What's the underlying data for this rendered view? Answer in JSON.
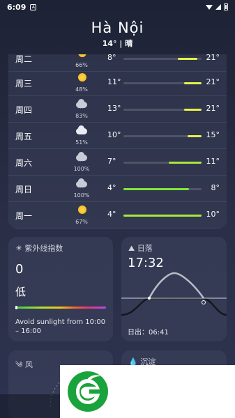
{
  "status": {
    "time": "6:09"
  },
  "header": {
    "city": "Hà Nội",
    "current": "14° | 晴"
  },
  "forecast": [
    {
      "day": "周二",
      "icon": "sun-icon",
      "precip": "66%",
      "low": "8°",
      "high": "21°",
      "bar_from": 0.7,
      "bar_to": 0.95,
      "color": "#e8f04a"
    },
    {
      "day": "周三",
      "icon": "sun-icon",
      "precip": "48%",
      "low": "11°",
      "high": "21°",
      "bar_from": 0.78,
      "bar_to": 1.0,
      "color": "#e8f04a"
    },
    {
      "day": "周四",
      "icon": "rain-icon",
      "precip": "83%",
      "low": "13°",
      "high": "21°",
      "bar_from": 0.78,
      "bar_to": 1.0,
      "color": "#e8f04a"
    },
    {
      "day": "周五",
      "icon": "cloud-icon",
      "precip": "51%",
      "low": "10°",
      "high": "15°",
      "bar_from": 0.82,
      "bar_to": 1.0,
      "color": "#e8f04a"
    },
    {
      "day": "周六",
      "icon": "rain-icon",
      "precip": "100%",
      "low": "7°",
      "high": "11°",
      "bar_from": 0.58,
      "bar_to": 1.0,
      "color": "#a8e83a"
    },
    {
      "day": "周日",
      "icon": "rain-icon",
      "precip": "100%",
      "low": "4°",
      "high": "8°",
      "bar_from": 0.0,
      "bar_to": 0.84,
      "color": "#7ee83a"
    },
    {
      "day": "周一",
      "icon": "sun-icon",
      "precip": "67%",
      "low": "4°",
      "high": "10°",
      "bar_from": 0.0,
      "bar_to": 1.0,
      "color": "#a8e83a"
    }
  ],
  "uv": {
    "title": "☀ 紫外线指数",
    "value": "0",
    "level": "低",
    "advice": "Avoid sunlight from 10:00 – 16:00"
  },
  "sunset": {
    "title": "⛰ 日落",
    "time": "17:32",
    "sunrise": "日出：06:41"
  },
  "wind": {
    "title": "༄ 风"
  },
  "precipitation": {
    "title": "💧 沉淀"
  },
  "colors": {
    "accent_green": "#1aa33c",
    "bar_yellow": "#e8f04a"
  }
}
